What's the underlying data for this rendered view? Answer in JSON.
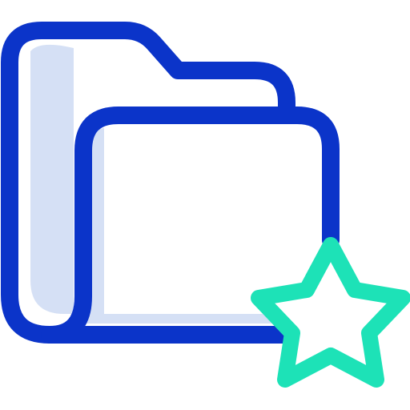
{
  "icon": {
    "name": "favorite-folder-icon",
    "parts": [
      "folder-icon",
      "star-icon"
    ],
    "colors": {
      "outline": "#0b34c9",
      "fill_shadow": "#d5e0f5",
      "accent": "#1de2b7",
      "background": "#ffffff"
    }
  }
}
